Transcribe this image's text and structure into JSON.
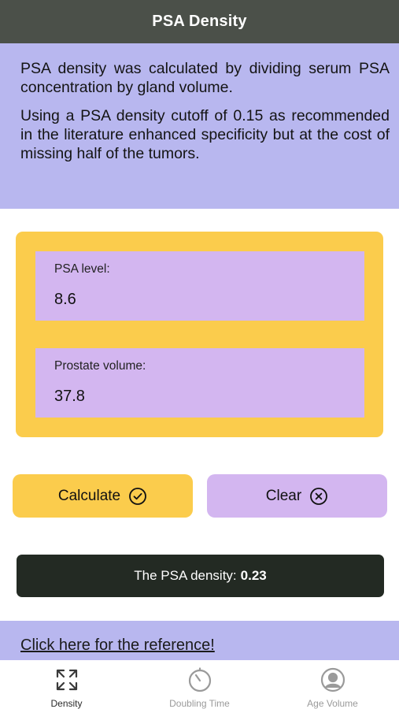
{
  "header": {
    "title": "PSA Density"
  },
  "info": {
    "paragraph1": "PSA density was calculated by dividing serum PSA concentration by gland volume.",
    "paragraph2": "Using a PSA density cutoff of 0.15 as recommended in the literature enhanced specificity but at the cost of missing half of the tumors."
  },
  "form": {
    "psa_level": {
      "label": "PSA level:",
      "value": "8.6"
    },
    "prostate_volume": {
      "label": "Prostate volume:",
      "value": "37.8"
    }
  },
  "actions": {
    "calculate_label": "Calculate",
    "calculate_icon": "check-circle-icon",
    "clear_label": "Clear",
    "clear_icon": "x-circle-icon"
  },
  "result": {
    "label": "The PSA density:",
    "value": "0.23"
  },
  "reference": {
    "link_text": "Click here for the reference!"
  },
  "tabs": [
    {
      "label": "Density",
      "icon": "expand-arrows-icon",
      "active": true
    },
    {
      "label": "Doubling Time",
      "icon": "stopwatch-icon",
      "active": false
    },
    {
      "label": "Age Volume",
      "icon": "user-circle-icon",
      "active": false
    }
  ],
  "colors": {
    "header_bg": "#4b5049",
    "panel_lavender": "#b8b7ef",
    "accent_yellow": "#fbcc4c",
    "field_purple": "#d3b6f0",
    "result_bg": "#232a23"
  }
}
